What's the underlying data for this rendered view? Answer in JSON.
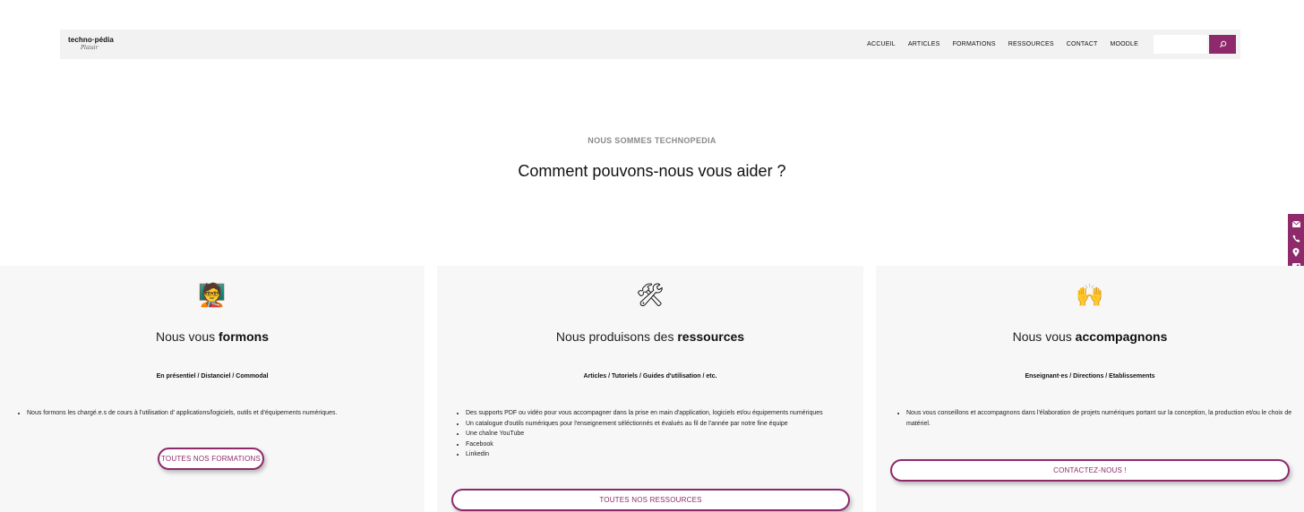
{
  "header": {
    "logo_main": "techno·pédia",
    "logo_sub": "Plaisir",
    "nav": [
      "ACCUEIL",
      "ARTICLES",
      "FORMATIONS",
      "RESSOURCES",
      "CONTACT",
      "MOODLE"
    ],
    "search_placeholder": "",
    "accent_color": "#8e2a6b"
  },
  "hero": {
    "eyebrow": "NOUS SOMMES TECHNOPEDIA",
    "headline": "Comment pouvons-nous vous aider ?"
  },
  "social_icons": [
    "email-icon",
    "phone-icon",
    "location-icon",
    "facebook-icon",
    "linkedin-icon"
  ],
  "cards": [
    {
      "icon": "🧑‍🏫",
      "title_prefix": "Nous vous ",
      "title_bold": "formons",
      "subtitle": "En présentiel / Distanciel / Commodal",
      "items": [
        "Nous formons les chargé.e.s de cours à l'utilisation d' applications/logiciels, outils et d'équipements numériques."
      ],
      "button": "TOUTES NOS FORMATIONS"
    },
    {
      "icon": "🛠",
      "title_prefix": "Nous produisons des ",
      "title_bold": "ressources",
      "subtitle": "Articles / Tutoriels / Guides d'utilisation / etc.",
      "items": [
        "Des supports PDF ou vidéo pour vous accompagner dans la prise en main d'application, logiciels et/ou équipements numériques",
        "Un catalogue d'outils numériques pour l'enseignement séléctionnés et évalués au fil de l'année par notre fine équipe",
        "Une chaîne YouTube",
        "Facebook",
        "Linkedin"
      ],
      "button": "TOUTES NOS RESSOURCES"
    },
    {
      "icon": "🙌",
      "title_prefix": "Nous vous ",
      "title_bold": "accompagnons",
      "subtitle": "Enseignant·es / Directions / Etablissements",
      "items": [
        "Nous vous conseillons et accompagnons dans l'élaboration de projets numériques portant sur la conception, la production et/ou le choix de matériel."
      ],
      "button": "CONTACTEZ-NOUS !"
    }
  ]
}
